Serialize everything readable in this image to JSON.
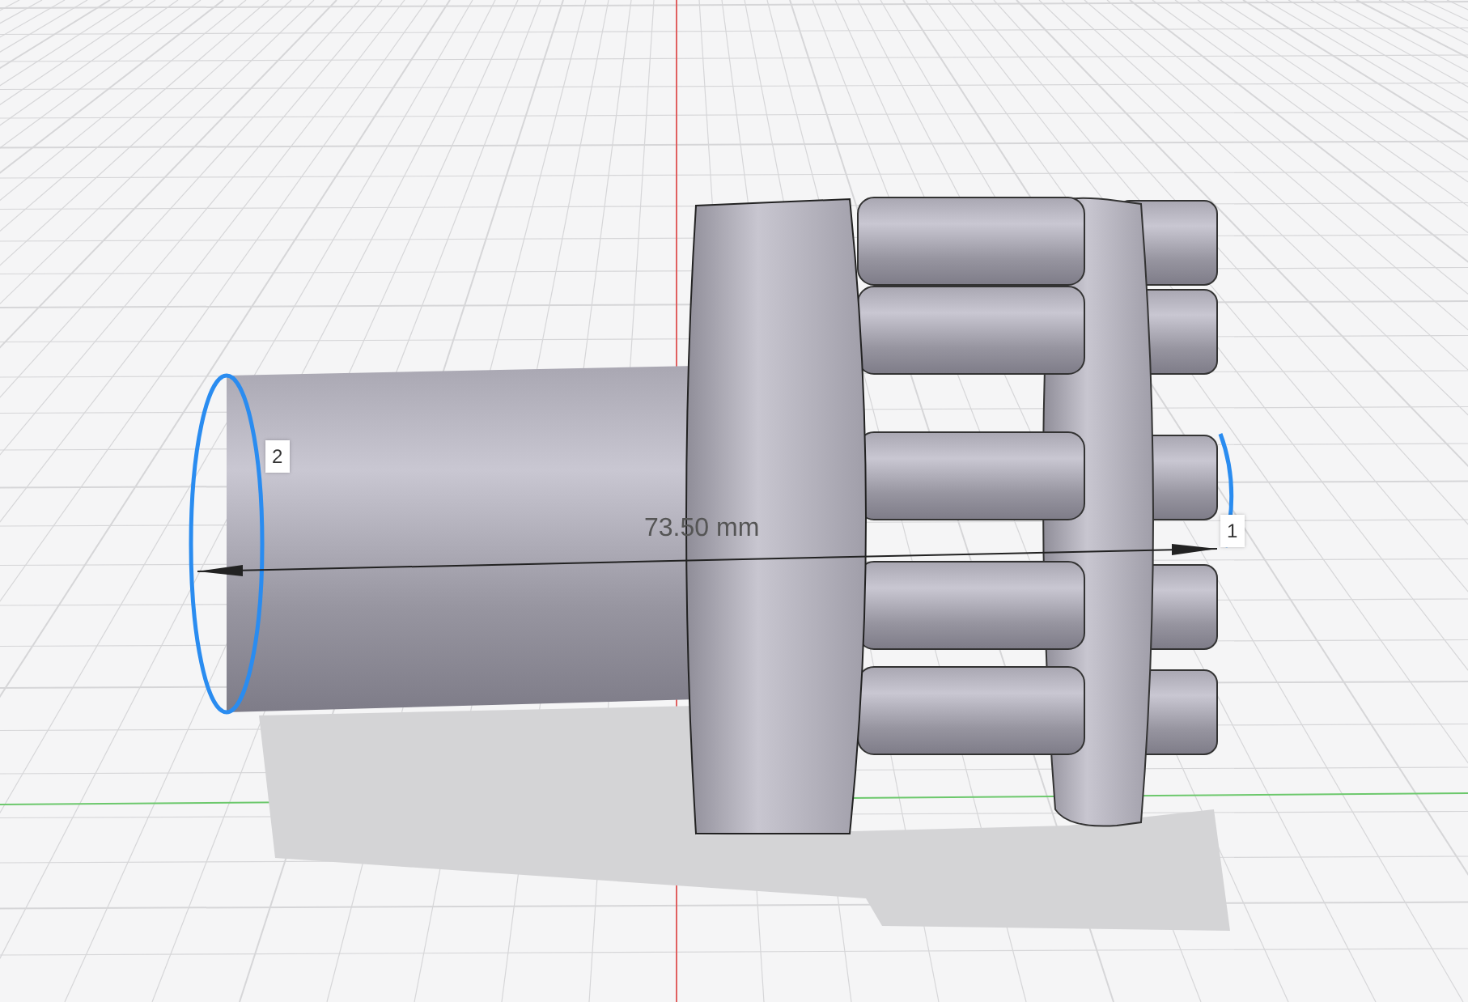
{
  "viewport": {
    "dimension": {
      "value": "73.50 mm"
    },
    "edges": [
      {
        "label": "2",
        "selected": true
      },
      {
        "label": "1",
        "selected": true
      }
    ]
  }
}
